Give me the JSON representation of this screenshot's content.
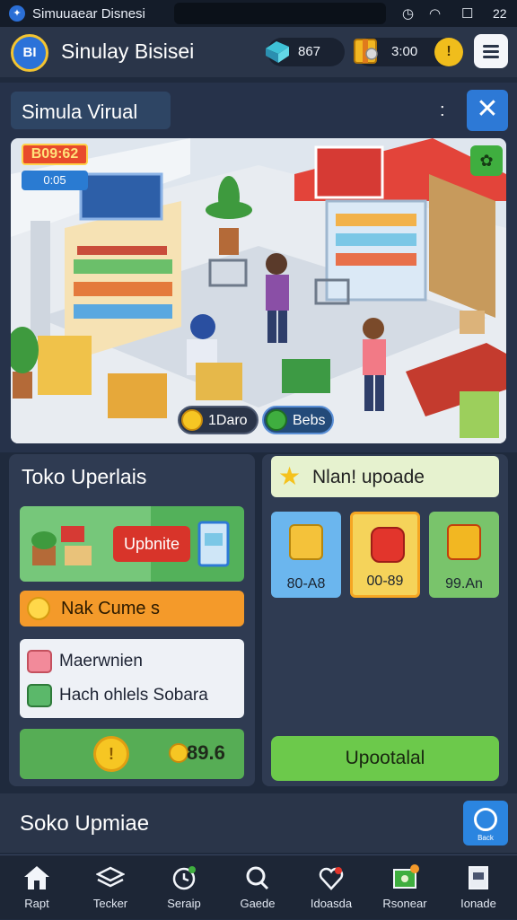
{
  "status_bar": {
    "app_title": "Simuuaear Disnesi",
    "time": "22"
  },
  "header": {
    "title": "Sinulay Bisisei",
    "gems": "867",
    "timer": "3:00",
    "add_symbol": "!"
  },
  "sim": {
    "title": "Simula Virual",
    "menu_symbol": ":",
    "close_symbol": "✕",
    "badge_top": "B09:62",
    "badge_sub": "0:05",
    "stat_coins": "1Daro",
    "stat_gems": "Bebs"
  },
  "store": {
    "title": "Toko Uperlais",
    "upgrade_button": "Upbnite",
    "promo": "Nak Cume s",
    "list": [
      {
        "label": "Maerwnien",
        "icon": "gift-box-icon"
      },
      {
        "label": "Hach ohlels Sobara",
        "icon": "shopping-bag-icon"
      }
    ],
    "coin_symbol": "!",
    "balance": "89.6"
  },
  "upgrades": {
    "title": "Nlan! upoade",
    "tiles": [
      {
        "label": "80-A8",
        "color": "#6bb6ee",
        "icon": "shelf-box-icon"
      },
      {
        "label": "00-89",
        "color": "#f5d35a",
        "icon": "cash-register-icon"
      },
      {
        "label": "99.An",
        "color": "#79c46b",
        "icon": "storage-bin-icon"
      }
    ],
    "upload_button": "Upootalal"
  },
  "footer": {
    "title": "Soko Upmiae",
    "button_label": "Back"
  },
  "nav": [
    {
      "label": "Rapt",
      "icon": "home-icon"
    },
    {
      "label": "Tecker",
      "icon": "layers-icon"
    },
    {
      "label": "Seraip",
      "icon": "clock-icon"
    },
    {
      "label": "Gaede",
      "icon": "search-icon"
    },
    {
      "label": "Idoasda",
      "icon": "heart-icon"
    },
    {
      "label": "Rsonear",
      "icon": "cash-icon"
    },
    {
      "label": "Ionade",
      "icon": "document-icon"
    }
  ],
  "colors": {
    "background": "#1f2a3d",
    "panel": "#2f3b52",
    "accent_blue": "#2d79d6",
    "accent_green": "#6cc94b",
    "accent_orange": "#f49a2a",
    "coin_gold": "#f6c623"
  }
}
